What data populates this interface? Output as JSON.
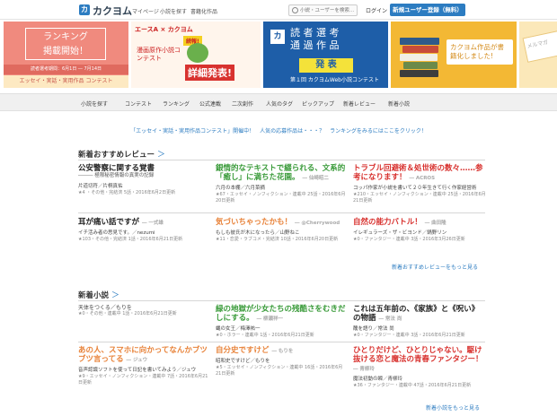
{
  "header": {
    "logo_mark": "カ",
    "logo_text": "カクヨム",
    "nav": [
      "マイページ",
      "小説を探す",
      "書籍化作品"
    ],
    "search_placeholder": "小説・ユーザーを検索...",
    "login": "ログイン",
    "signup": "新規ユーザー登録（無料）"
  },
  "banners": {
    "b1": {
      "line1": "ランキング",
      "line2": "掲載開始！",
      "period": "読者選考期間：6月1日 ― 7月14日",
      "contest": "エッセイ・実話・実用作品 コンテスト"
    },
    "b2": {
      "logo": "エースA × カクヨム",
      "new": "続報!",
      "title": "漫画原作小説コンテスト",
      "big": "詳細発表!"
    },
    "b3": {
      "mark": "カ",
      "title_1": "読 者 選 考",
      "title_2": "通 過 作 品",
      "hap": "発 表",
      "sub": "第１回 カクヨムWeb小説コンテスト"
    },
    "b4": {
      "text": "カクヨム作品が書籍化しました!"
    },
    "b5": {
      "text": "メルマガ"
    }
  },
  "colors": {
    "accent": "#2c7cc1",
    "green": "#3a9b3a",
    "orange": "#e8833a",
    "red": "#d8322f"
  },
  "categories": [
    "小説を探す",
    "コンテスト",
    "ランキング",
    "公式連載",
    "二次創作",
    "人気のタグ",
    "ピックアップ",
    "新着レビュー",
    "新着小説"
  ],
  "notice": "「エッセイ・実話・実用作品コンテスト」開催中！　人気の応募作品は・・・？　ランキングをみるにはここをクリック！",
  "reviews": {
    "title": "新着おすすめレビュー",
    "chev": "＞",
    "more": "新着おすすめレビューをもっと見る",
    "row1": [
      {
        "title": "公安警察に関する覚書",
        "sub": "――― 極限秘密情報の真実の記録",
        "tag": "",
        "author": "片道切符／片桐真佑",
        "meta": "★4 ・その他・完結済 5話・2016年6月2日更新"
      },
      {
        "title": "銀情的なテキストで綴られる、文系的「癒し」に満ちた花園。",
        "sub": "",
        "tag": "― 仙崎昭二",
        "author": "六月の本棚／六月菜摘",
        "meta": "★67・エッセイ・ノンフィクション・連載中 25話・2016年6月20日更新"
      },
      {
        "title": "トラブル回避術＆処世術の数々……参考になります！",
        "sub": "",
        "tag": "― ACROS",
        "author": "コッパ作家が小説を書いて２０年生きて行く作家経営術",
        "meta": "★210・エッセイ・ノンフィクション・連載中 25話・2016年6月21日更新"
      }
    ],
    "row2": [
      {
        "title": "耳が痛い話ですが",
        "sub": "イチ活み者の思見です。／nezumi",
        "tag": "― 一式雄",
        "author": "",
        "meta": "★103・その他・完結済 1話・2016年6月21日更新"
      },
      {
        "title": "気づいちゃったかも！",
        "sub": "",
        "tag": "― @Cherrywood",
        "author": "もしも彼氏が木になったら／山野ねこ",
        "meta": "★11・恋愛・ラブコメ・完結済 10話・2016年6月20日更新"
      },
      {
        "title": "自然の能力バトル！",
        "sub": "",
        "tag": "― 曲田隆",
        "author": "イレギュラーズ・ザ・ビヨンド／鍋野リン",
        "meta": "★0・ファンタジー・連載中 3話・2016年3月26日更新"
      }
    ]
  },
  "novels": {
    "title": "新着小説",
    "chev": "＞",
    "more": "新着小説をもっと見る",
    "row1": [
      {
        "title": "天体をつくる／もりを",
        "tag": "",
        "author": "",
        "meta": "★0・その他・連載中 1話・2016年6月21日更新"
      },
      {
        "title": "緑の地獄が少女たちの残酷さをむきだしにする。",
        "tag": "― 柳瀬祥一",
        "author": "蝿の女王／梅澤祐一",
        "meta": "★0・ホラー・連載中 1話・2016年6月21日更新"
      },
      {
        "title": "これは五年前の、《家族》と《呪い》の物語",
        "tag": "― 常法 尚",
        "author": "醜を語り／常法 尚",
        "meta": "★0・ファンタジー・連載中 3話・2016年6月21日更新"
      }
    ],
    "row2": [
      {
        "title": "あの人、スマホに向かってなんかブツブツ言ってる",
        "tag": "― ジュウ",
        "author": "音声認識ソフトを使って日記を書いてみよう／ジュウ",
        "meta": "★9・エッセイ・ノンフィクション・連載中 7話・2016年6月21日更新"
      },
      {
        "title": "自分史ですけど",
        "tag": "― もりを",
        "author": "昭和史ですけど／もりを",
        "meta": "★5・エッセイ・ノンフィクション・連載中 16話・2016年6月21日更新"
      },
      {
        "title": "ひとりだけど、ひとりじゃない。駆け抜ける恋と魔法の青春ファンタジー！",
        "tag": "― 青柳玲",
        "author": "魔法初動の瞬／青柳玲",
        "meta": "★36・ファンタジー・連載中 47話・2016年6月21日更新"
      }
    ]
  }
}
